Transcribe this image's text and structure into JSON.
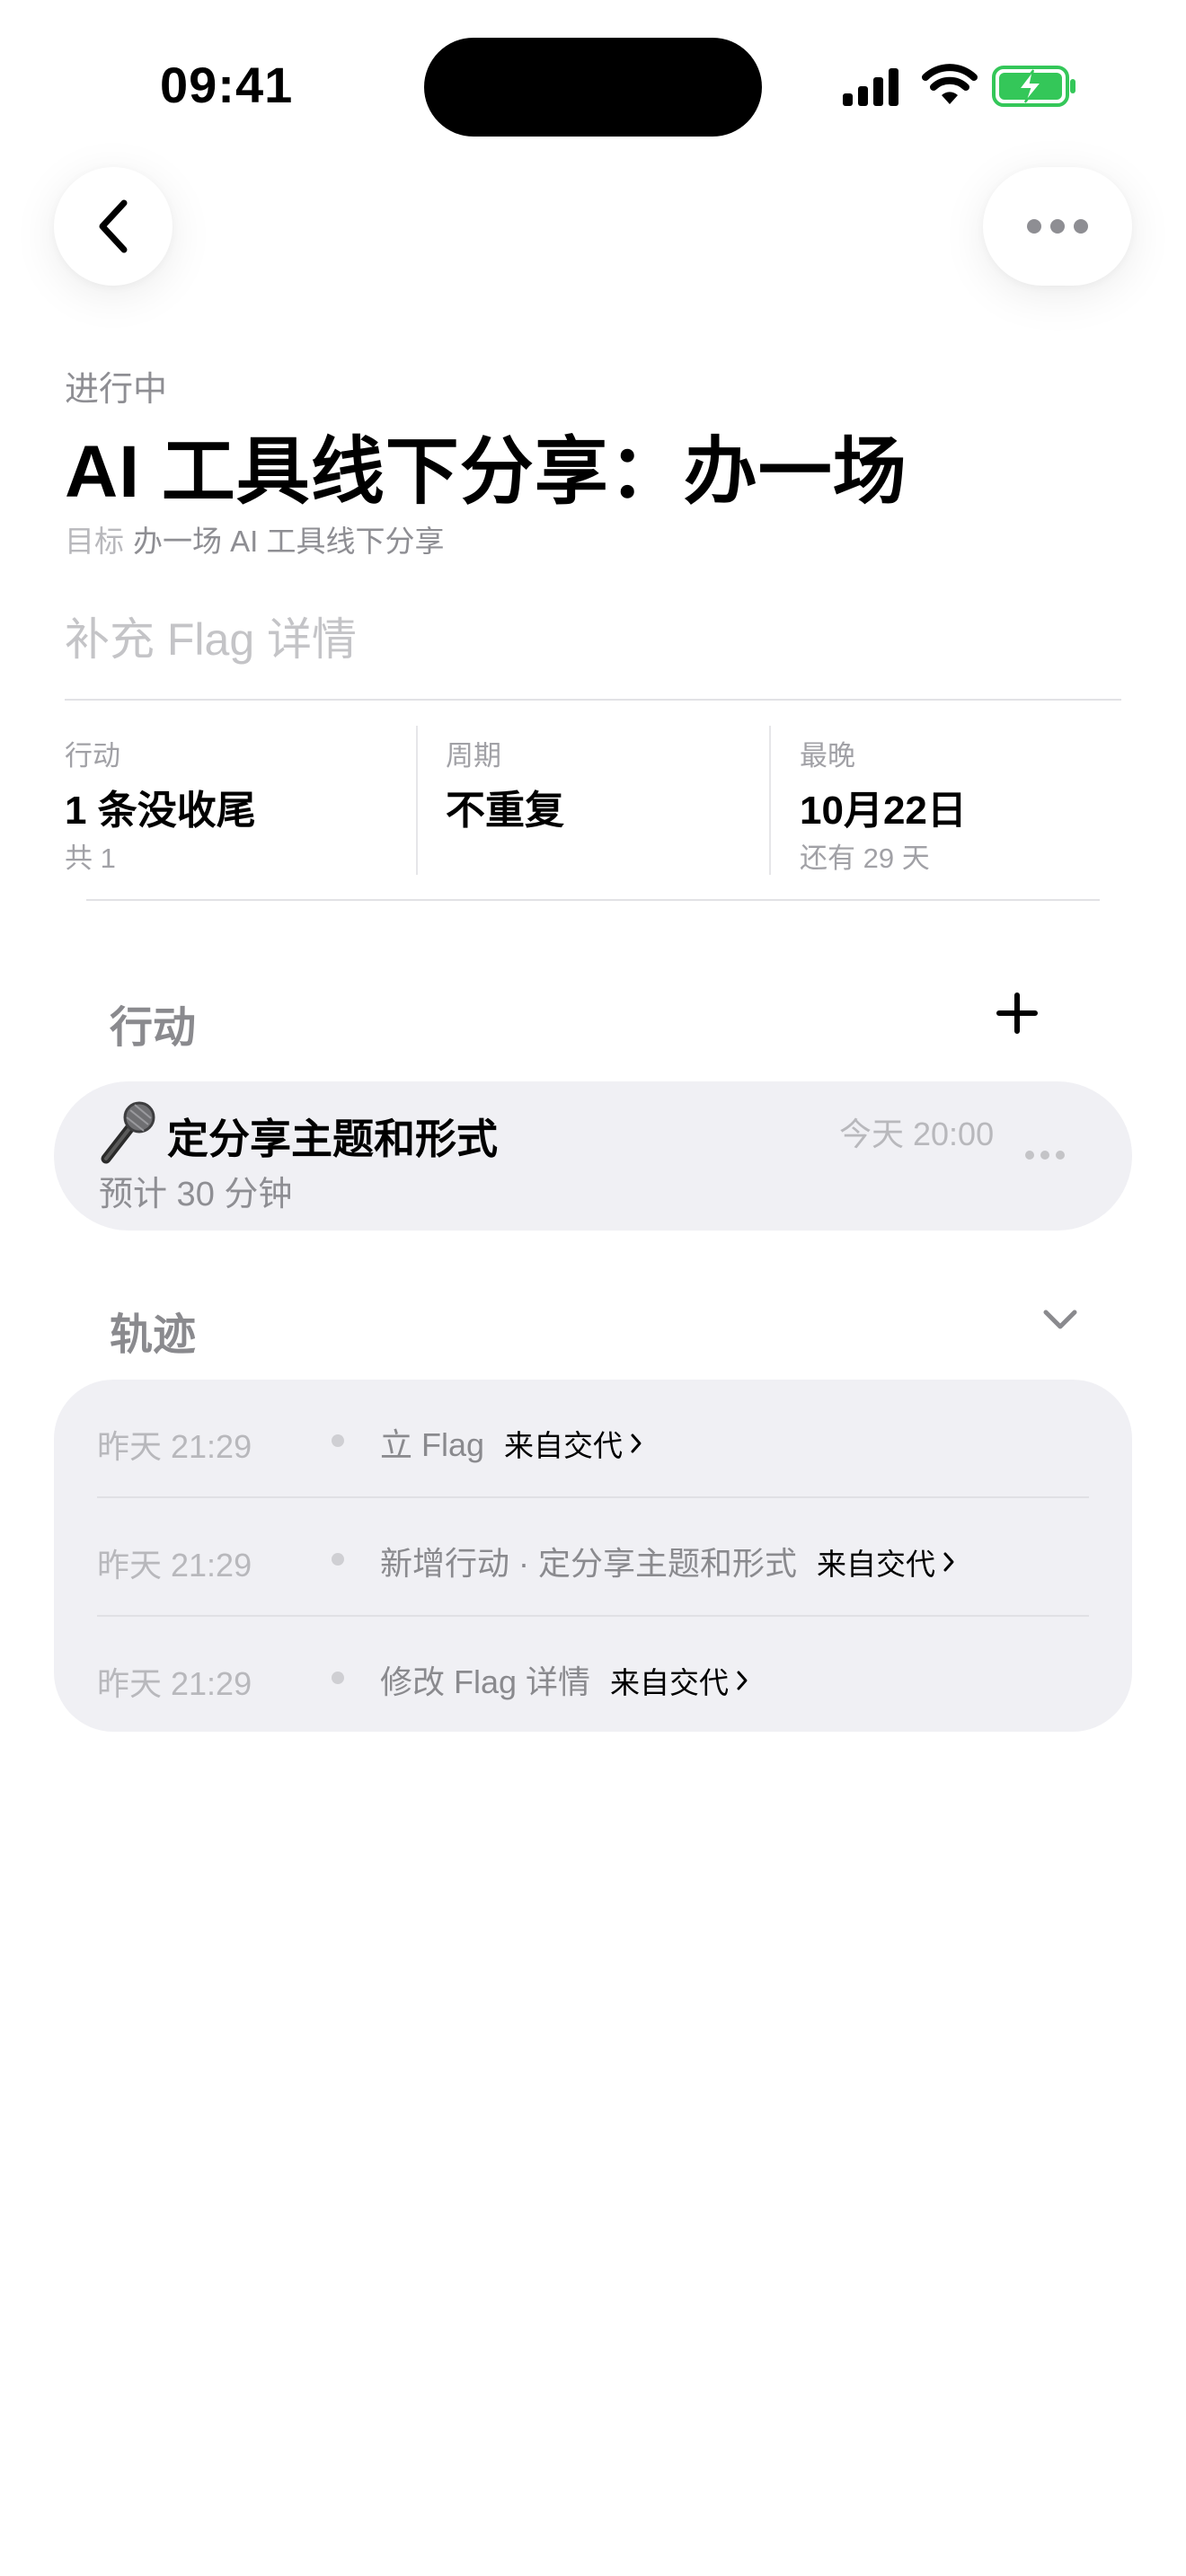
{
  "status_bar": {
    "time": "09:41"
  },
  "header": {
    "status": "进行中",
    "title": "AI 工具线下分享：办一场",
    "goal_prefix": "目标",
    "goal_text": "办一场 AI 工具线下分享",
    "detail_placeholder": "补充 Flag 详情"
  },
  "stats": [
    {
      "label": "行动",
      "value": "1 条没收尾",
      "sub": "共 1"
    },
    {
      "label": "周期",
      "value": "不重复",
      "sub": ""
    },
    {
      "label": "最晚",
      "value": "10月22日",
      "sub": "还有 29 天"
    }
  ],
  "actions_section": {
    "title": "行动",
    "items": [
      {
        "title": "定分享主题和形式",
        "time": "今天 20:00",
        "estimate": "预计 30 分钟",
        "icon": "microphone-icon"
      }
    ]
  },
  "timeline_section": {
    "title": "轨迹",
    "rows": [
      {
        "time": "昨天 21:29",
        "text": "立 Flag",
        "source": "来自交代"
      },
      {
        "time": "昨天 21:29",
        "text": "新增行动 · 定分享主题和形式",
        "source": "来自交代"
      },
      {
        "time": "昨天 21:29",
        "text": "修改 Flag 详情",
        "source": "来自交代"
      }
    ]
  },
  "colors": {
    "battery_green": "#34c759",
    "card_bg": "#f0f0f4",
    "muted_text": "#8e8e93"
  }
}
